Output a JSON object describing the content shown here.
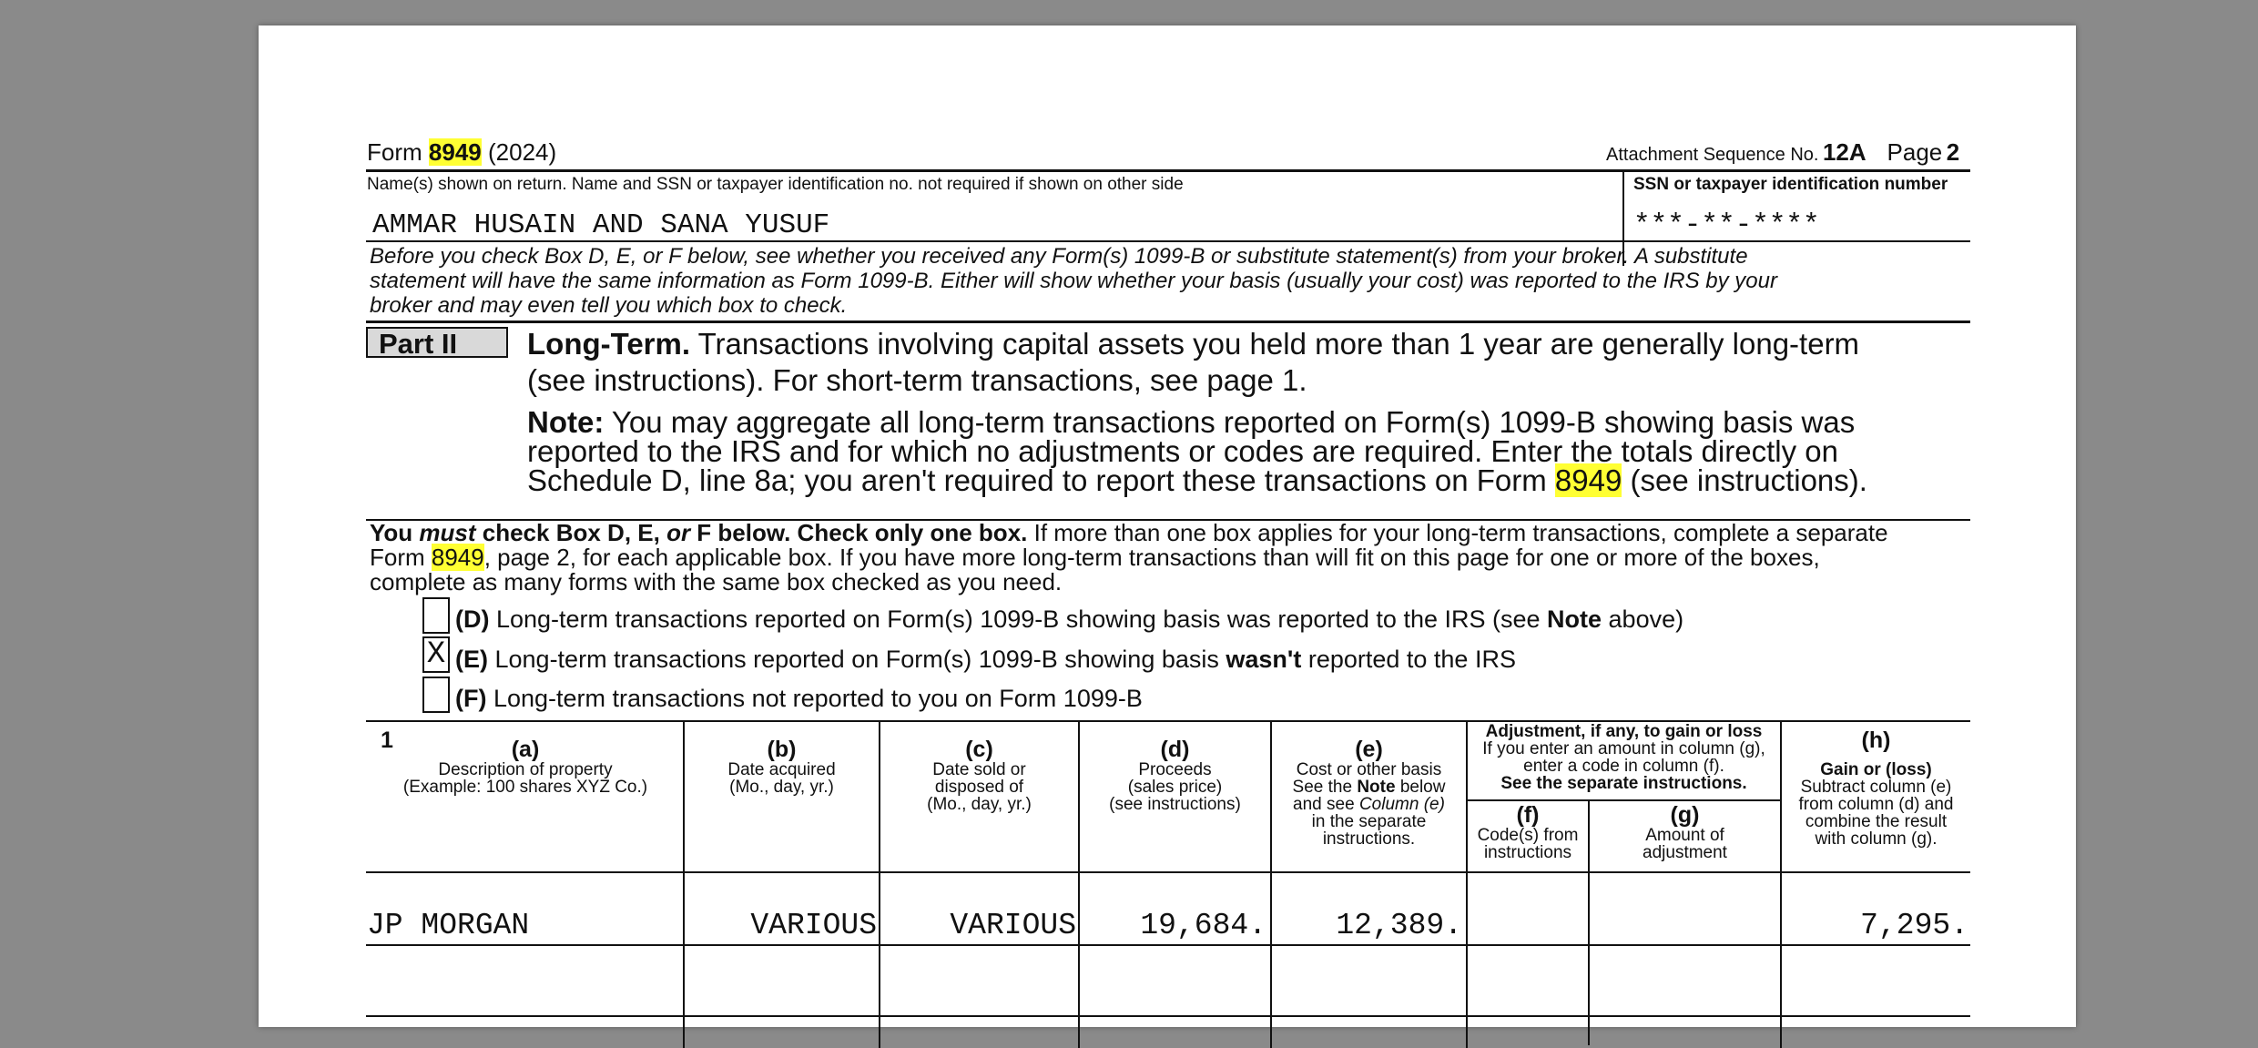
{
  "header": {
    "form_prefix": "Form",
    "form_number": "8949",
    "form_year": "(2024)",
    "attachment_label": "Attachment Sequence No.",
    "attachment_no": "12A",
    "page_label": "Page",
    "page_no": "2"
  },
  "names": {
    "label": "Name(s) shown on return. Name and SSN or taxpayer identification no. not required if shown on other side",
    "value": "AMMAR HUSAIN AND SANA YUSUF",
    "ssn_label": "SSN or taxpayer identification number",
    "ssn_value": "***-**-****"
  },
  "intro_text": {
    "line1": "Before you check Box D, E, or F below, see whether you received any Form(s) 1099-B or substitute statement(s) from your broker. A substitute",
    "line2": "statement will have the same information as Form 1099-B. Either will show whether your basis (usually your cost) was reported to the IRS by your",
    "line3": "broker and may even tell you which box to check."
  },
  "part": {
    "badge": "Part II",
    "heading_bold": "Long-Term.",
    "heading_line1": " Transactions involving capital assets you held more than 1 year are generally long-term",
    "heading_line2": "(see instructions). For short-term transactions, see page 1.",
    "note_bold": "Note:",
    "note_line1": " You may aggregate all long-term transactions reported on Form(s) 1099-B showing basis was",
    "note_line2": "reported to the IRS and for which no adjustments or codes are required. Enter the totals directly on",
    "note_line3a": "Schedule D, line 8a; you aren't required to report these transactions on Form ",
    "note_form": "8949",
    "note_line3b": " (see instructions)."
  },
  "must_check": {
    "you": "You ",
    "must": "must",
    "check_box": " check Box D, E, ",
    "or": "or",
    "f_below": " F below. Check only one box.",
    "line1_rest": " If more than one box applies for your long-term transactions, complete a separate",
    "line2_pre": "Form ",
    "line2_form": "8949",
    "line2_rest": ", page 2, for each applicable box. If you have more long-term transactions than will fit on this page for one or more of the boxes,",
    "line3": "complete as many forms with the same box checked as you need."
  },
  "boxes": [
    {
      "letter": "(D)",
      "mark": "",
      "pre": " Long-term transactions reported on Form(s) 1099-B showing basis was reported to the IRS (see ",
      "bold": "Note",
      "post": " above)"
    },
    {
      "letter": "(E)",
      "mark": "X",
      "pre": " Long-term transactions reported on Form(s) 1099-B showing basis ",
      "bold": "wasn't",
      "post": " reported to the IRS"
    },
    {
      "letter": "(F)",
      "mark": "",
      "pre": " Long-term transactions not reported to you on Form 1099-B",
      "bold": "",
      "post": ""
    }
  ],
  "table": {
    "line_no": "1",
    "col_a": {
      "letter": "(a)",
      "l1": "Description of property",
      "l2": "(Example: 100 shares XYZ Co.)"
    },
    "col_b": {
      "letter": "(b)",
      "l1": "Date acquired",
      "l2": "(Mo., day, yr.)"
    },
    "col_c": {
      "letter": "(c)",
      "l1": "Date sold or",
      "l2": "disposed of",
      "l3": "(Mo., day, yr.)"
    },
    "col_d": {
      "letter": "(d)",
      "l1": "Proceeds",
      "l2": "(sales price)",
      "l3": "(see instructions)"
    },
    "col_e": {
      "letter": "(e)",
      "l1": "Cost or other basis",
      "l2a": "See the ",
      "l2b": "Note",
      "l2c": " below",
      "l3a": "and see ",
      "l3b": "Column (e)",
      "l4": "in the separate",
      "l5": "instructions."
    },
    "adj": {
      "title": "Adjustment, if any, to gain or loss",
      "l1": "If you enter an amount in column (g),",
      "l2": "enter a code in column (f).",
      "l3": "See the separate instructions."
    },
    "col_f": {
      "letter": "(f)",
      "l1": "Code(s) from",
      "l2": "instructions"
    },
    "col_g": {
      "letter": "(g)",
      "l1": "Amount of",
      "l2": "adjustment"
    },
    "col_h": {
      "letter": "(h)",
      "l1": "Gain or (loss)",
      "l2": "Subtract column (e)",
      "l3": "from column (d) and",
      "l4": "combine the result",
      "l5": "with column (g)."
    },
    "rows": [
      {
        "a": "JP MORGAN",
        "b": "VARIOUS",
        "c": "VARIOUS",
        "d": "19,684.",
        "e": "12,389.",
        "f": "",
        "g": "",
        "h": "7,295."
      }
    ]
  }
}
